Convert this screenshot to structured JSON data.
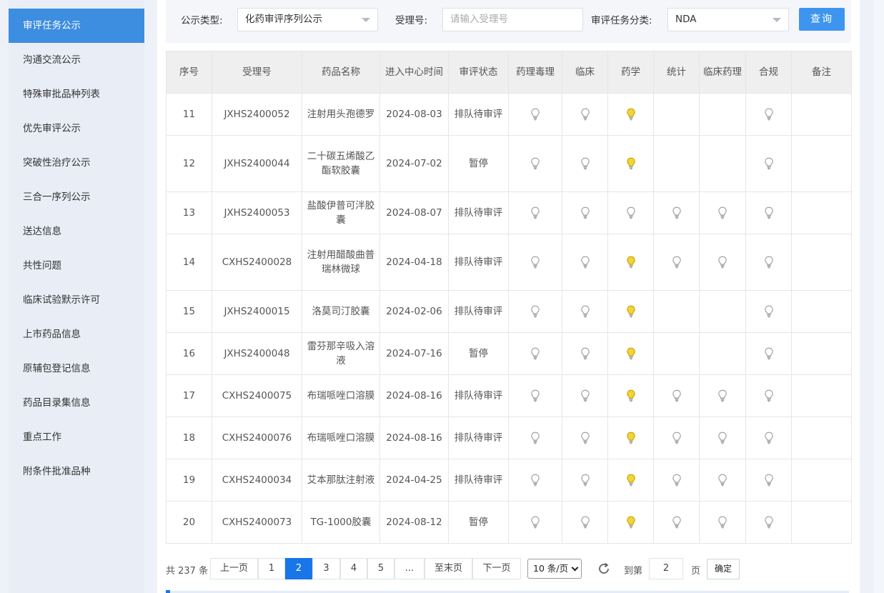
{
  "sidebar": {
    "items": [
      {
        "label": "审评任务公示",
        "active": true
      },
      {
        "label": "沟通交流公示"
      },
      {
        "label": "特殊审批品种列表"
      },
      {
        "label": "优先审评公示"
      },
      {
        "label": "突破性治疗公示"
      },
      {
        "label": "三合一序列公示"
      },
      {
        "label": "送达信息"
      },
      {
        "label": "共性问题"
      },
      {
        "label": "临床试验默示许可"
      },
      {
        "label": "上市药品信息"
      },
      {
        "label": "原辅包登记信息"
      },
      {
        "label": "药品目录集信息"
      },
      {
        "label": "重点工作"
      },
      {
        "label": "附条件批准品种"
      }
    ]
  },
  "filters": {
    "type_label": "公示类型:",
    "type_value": "化药审评序列公示",
    "accept_label": "受理号:",
    "accept_placeholder": "请输入受理号",
    "category_label": "审评任务分类:",
    "category_value": "NDA",
    "query_label": "查询"
  },
  "table": {
    "headers": [
      "序号",
      "受理号",
      "药品名称",
      "进入中心时间",
      "审评状态",
      "药理毒理",
      "临床",
      "药学",
      "统计",
      "临床药理",
      "合规",
      "备注"
    ],
    "rows": [
      {
        "no": "11",
        "id": "JXHS2400052",
        "name": "注射用头孢德罗",
        "date": "2024-08-03",
        "status": "排队待审评",
        "lights": [
          "gray",
          "gray",
          "yellow",
          "",
          "",
          "gray"
        ]
      },
      {
        "no": "12",
        "id": "JXHS2400044",
        "name": "二十碳五烯酸乙酯软胶囊",
        "date": "2024-07-02",
        "status": "暂停",
        "lights": [
          "gray",
          "gray",
          "yellow",
          "",
          "",
          "gray"
        ]
      },
      {
        "no": "13",
        "id": "JXHS2400053",
        "name": "盐酸伊普可泮胶囊",
        "date": "2024-08-07",
        "status": "排队待审评",
        "lights": [
          "gray",
          "gray",
          "gray",
          "gray",
          "gray",
          "gray"
        ]
      },
      {
        "no": "14",
        "id": "CXHS2400028",
        "name": "注射用醋酸曲普瑞林微球",
        "date": "2024-04-18",
        "status": "排队待审评",
        "lights": [
          "gray",
          "gray",
          "yellow",
          "gray",
          "gray",
          "gray"
        ]
      },
      {
        "no": "15",
        "id": "JXHS2400015",
        "name": "洛莫司汀胶囊",
        "date": "2024-02-06",
        "status": "排队待审评",
        "lights": [
          "gray",
          "gray",
          "yellow",
          "",
          "",
          "gray"
        ]
      },
      {
        "no": "16",
        "id": "JXHS2400048",
        "name": "雷芬那辛吸入溶液",
        "date": "2024-07-16",
        "status": "暂停",
        "lights": [
          "gray",
          "gray",
          "yellow",
          "",
          "",
          "gray"
        ]
      },
      {
        "no": "17",
        "id": "CXHS2400075",
        "name": "布瑞哌唑口溶膜",
        "date": "2024-08-16",
        "status": "排队待审评",
        "lights": [
          "gray",
          "gray",
          "yellow",
          "gray",
          "gray",
          "gray"
        ]
      },
      {
        "no": "18",
        "id": "CXHS2400076",
        "name": "布瑞哌唑口溶膜",
        "date": "2024-08-16",
        "status": "排队待审评",
        "lights": [
          "gray",
          "gray",
          "yellow",
          "gray",
          "gray",
          "gray"
        ]
      },
      {
        "no": "19",
        "id": "CXHS2400034",
        "name": "艾本那肽注射液",
        "date": "2024-04-25",
        "status": "排队待审评",
        "lights": [
          "gray",
          "gray",
          "yellow",
          "gray",
          "gray",
          "gray"
        ]
      },
      {
        "no": "20",
        "id": "CXHS2400073",
        "name": "TG-1000胶囊",
        "date": "2024-08-12",
        "status": "暂停",
        "lights": [
          "gray",
          "gray",
          "yellow",
          "gray",
          "gray",
          "gray"
        ]
      }
    ]
  },
  "pagination": {
    "total_text": "共 237 条",
    "prev": "上一页",
    "pages": [
      "1",
      "2",
      "3",
      "4",
      "5",
      "..."
    ],
    "current": "2",
    "last": "至末页",
    "next": "下一页",
    "page_size": "10 条/页",
    "goto_label": "到第",
    "goto_value": "2",
    "page_unit": "页",
    "confirm": "确定"
  },
  "colors": {
    "accent": "#3d8de0",
    "button": "#3e95f0",
    "active_page": "#1976e8",
    "bulb_on": "#f2d43a",
    "bulb_off": "#d6d6d6"
  }
}
